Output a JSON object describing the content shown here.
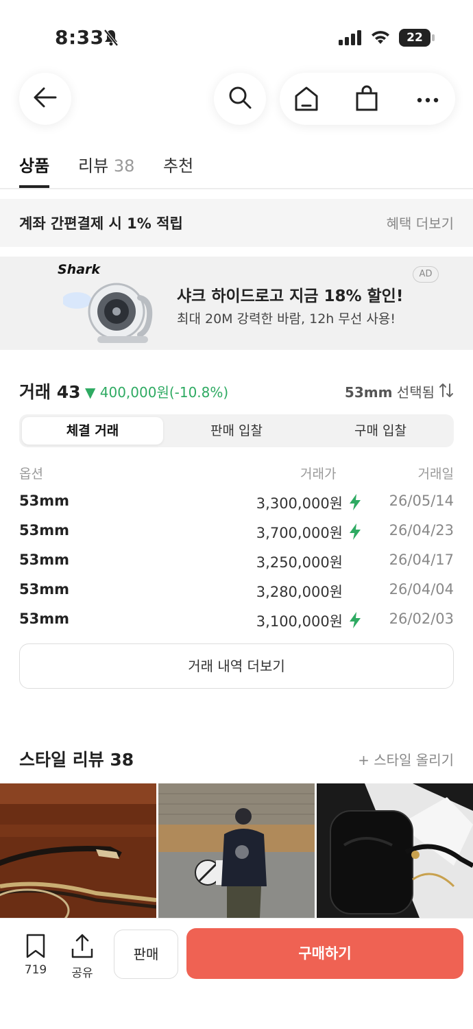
{
  "status_bar": {
    "time": "8:33",
    "battery": "22"
  },
  "tabs": [
    {
      "label": "상품",
      "count": ""
    },
    {
      "label": "리뷰",
      "count": "38"
    },
    {
      "label": "추천",
      "count": ""
    }
  ],
  "benefit": {
    "label": "계좌 간편결제 시 1% 적립",
    "more": "혜택 더보기"
  },
  "ad": {
    "brand": "Shark",
    "headline": "샤크 하이드로고 지금 18% 할인!",
    "sub": "최대 20M 강력한 바람, 12h 무선 사용!",
    "badge": "AD"
  },
  "trade": {
    "title": "거래 43",
    "change": "▼ 400,000원(-10.8%)",
    "selected_size": "53mm",
    "selected_label": " 선택됨",
    "segments": [
      "체결 거래",
      "판매 입찰",
      "구매 입찰"
    ],
    "columns": [
      "옵션",
      "거래가",
      "거래일"
    ],
    "rows": [
      {
        "option": "53mm",
        "price": "3,300,000원",
        "date": "26/05/14",
        "quick": true
      },
      {
        "option": "53mm",
        "price": "3,700,000원",
        "date": "26/04/23",
        "quick": true
      },
      {
        "option": "53mm",
        "price": "3,250,000원",
        "date": "26/04/17",
        "quick": false
      },
      {
        "option": "53mm",
        "price": "3,280,000원",
        "date": "26/04/04",
        "quick": false
      },
      {
        "option": "53mm",
        "price": "3,100,000원",
        "date": "26/02/03",
        "quick": true
      }
    ],
    "more_button": "거래 내역 더보기"
  },
  "style_review": {
    "title": "스타일 리뷰 38",
    "upload": "+ 스타일 올리기"
  },
  "bottom_bar": {
    "bookmark_count": "719",
    "share_label": "공유",
    "sell_label": "판매",
    "buy_label": "구매하기"
  },
  "colors": {
    "accent_buy": "#ef6253",
    "price_down": "#2eaa62",
    "quick_flash": "#2eaa62"
  }
}
